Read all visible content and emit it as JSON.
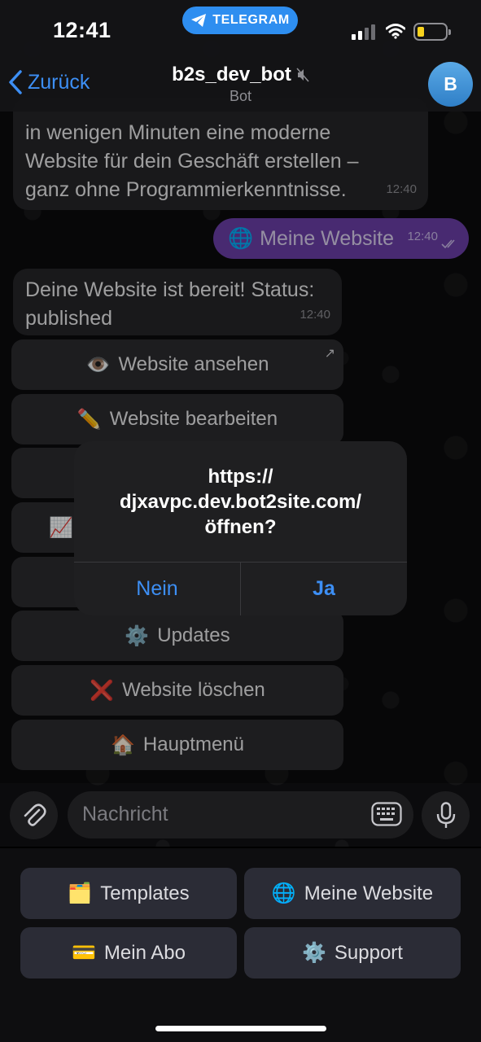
{
  "status_bar": {
    "time": "12:41",
    "return_app": "TELEGRAM"
  },
  "header": {
    "back_label": "Zurück",
    "title": "b2s_dev_bot",
    "subtitle": "Bot",
    "avatar_letter": "B"
  },
  "messages": [
    {
      "text_lines": [
        "in wenigen Minuten eine moderne",
        "Website für dein Geschäft erstellen –",
        "ganz ohne Programmierkenntnisse."
      ],
      "time": "12:40"
    },
    {
      "text": "Meine Website",
      "time": "12:40"
    },
    {
      "text_lines": [
        "Deine Website ist bereit! Status:",
        "published"
      ],
      "time": "12:40"
    }
  ],
  "inline_buttons": [
    {
      "emoji": "👁️",
      "label": "Website ansehen"
    },
    {
      "emoji": "✏️",
      "label": "Website bearbeiten"
    },
    {
      "emoji": "",
      "label": ""
    },
    {
      "emoji": "📈",
      "label": ""
    },
    {
      "emoji": "",
      "label": ""
    },
    {
      "emoji": "⚙️",
      "label": "Updates"
    },
    {
      "emoji": "❌",
      "label": "Website löschen"
    },
    {
      "emoji": "🏠",
      "label": "Hauptmenü"
    }
  ],
  "alert": {
    "line1": "https://",
    "line2": "djxavpc.dev.bot2site.com/",
    "line3": "öffnen?",
    "cancel": "Nein",
    "confirm": "Ja"
  },
  "composer": {
    "placeholder": "Nachricht"
  },
  "reply_keyboard": [
    {
      "emoji": "🗂️",
      "label": "Templates"
    },
    {
      "emoji": "🌐",
      "label": "Meine Website"
    },
    {
      "emoji": "💳",
      "label": "Mein Abo"
    },
    {
      "emoji": "⚙️",
      "label": "Support"
    }
  ],
  "colors": {
    "accent": "#3d8ff5",
    "outgoing_bubble": "#6a3fa7",
    "incoming_bubble": "#262628",
    "telegram_pill": "#2e8ef0"
  }
}
